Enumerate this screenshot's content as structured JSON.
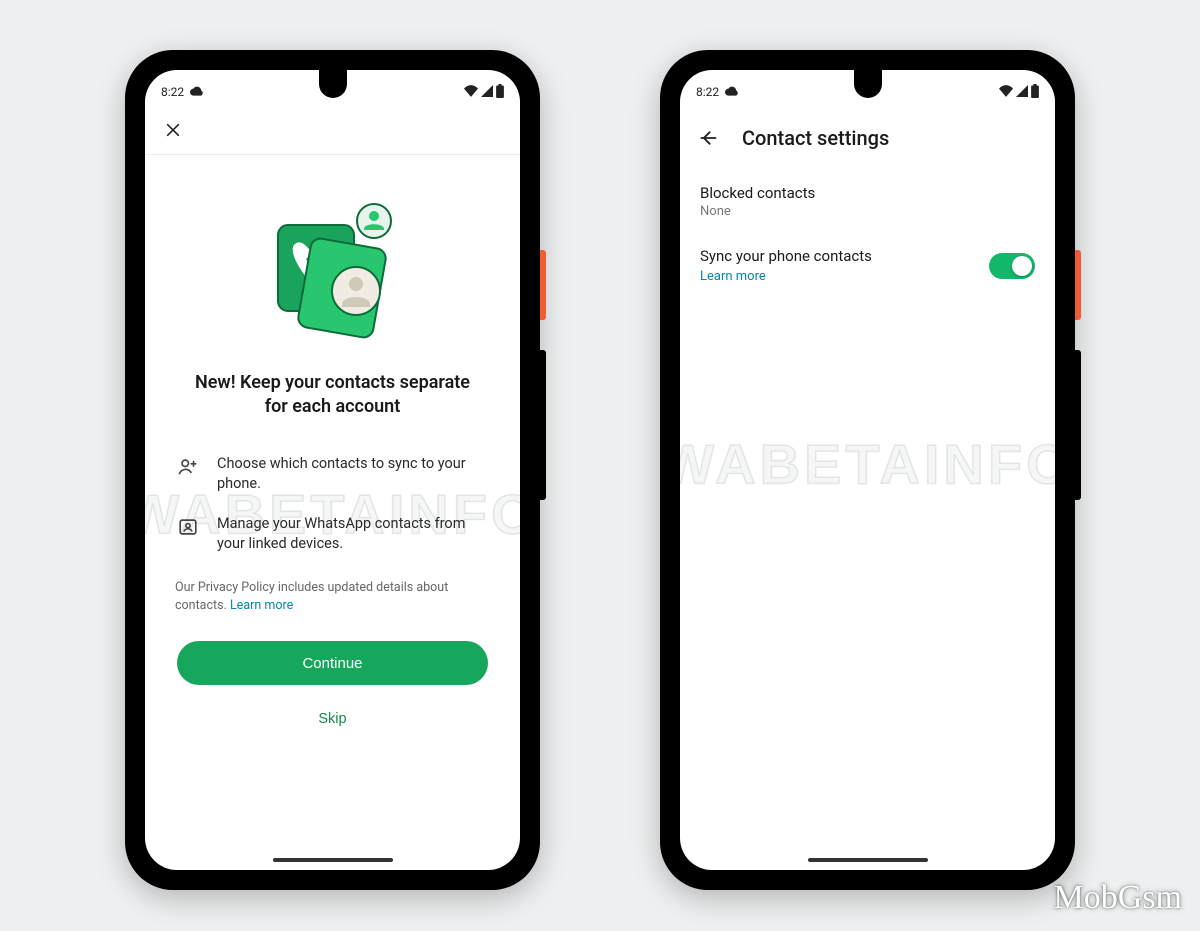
{
  "statusbar": {
    "time": "8:22"
  },
  "screen1": {
    "title": "New! Keep your contacts separate for each account",
    "bullets": [
      {
        "text": "Choose which contacts to sync to your phone."
      },
      {
        "text": "Manage your WhatsApp contacts from your linked devices."
      }
    ],
    "policy_prefix": "Our Privacy Policy includes updated details about contacts. ",
    "policy_link": "Learn more",
    "continue": "Continue",
    "skip": "Skip"
  },
  "screen2": {
    "title": "Contact settings",
    "blocked_label": "Blocked contacts",
    "blocked_value": "None",
    "sync_label": "Sync your phone contacts",
    "learn_more": "Learn more",
    "toggle_on": true
  },
  "watermarks": {
    "center": "WABETAINFO",
    "corner": "MobGsm"
  }
}
